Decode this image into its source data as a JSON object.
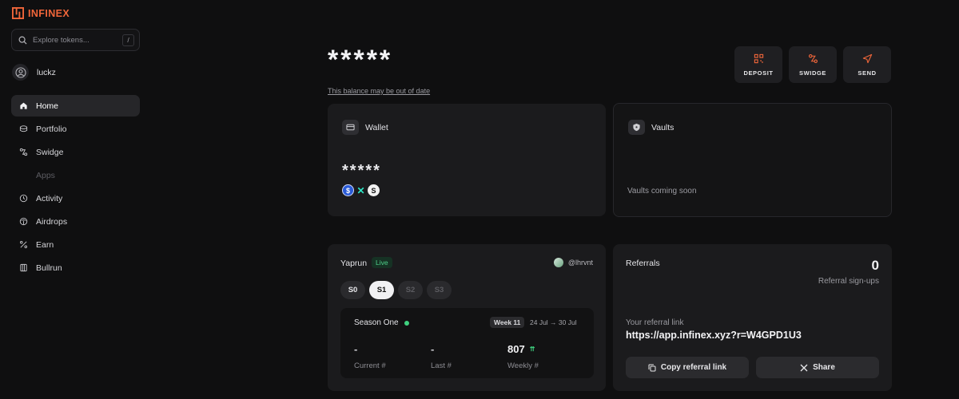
{
  "brand": {
    "name": "INFINEX",
    "accent": "#f0663a"
  },
  "search": {
    "placeholder": "Explore tokens...",
    "shortcut": "/"
  },
  "user": {
    "name": "luckz"
  },
  "nav": [
    {
      "label": "Home",
      "icon": "home-icon",
      "active": true
    },
    {
      "label": "Portfolio",
      "icon": "coins-icon"
    },
    {
      "label": "Swidge",
      "icon": "swidge-icon"
    },
    {
      "label": "Apps",
      "icon": "apps-icon",
      "disabled": true
    },
    {
      "label": "Activity",
      "icon": "clock-icon"
    },
    {
      "label": "Airdrops",
      "icon": "airdrop-icon"
    },
    {
      "label": "Earn",
      "icon": "percent-icon"
    },
    {
      "label": "Bullrun",
      "icon": "book-icon"
    }
  ],
  "header": {
    "balance": "*****",
    "balance_note": "This balance may be out of date",
    "actions": {
      "deposit": "DEPOSIT",
      "swidge": "SWIDGE",
      "send": "SEND"
    }
  },
  "wallet": {
    "title": "Wallet",
    "amount": "*****",
    "tokens": [
      "usdc-icon",
      "x-token-icon",
      "s-token-icon"
    ]
  },
  "vaults": {
    "title": "Vaults",
    "note": "Vaults coming soon"
  },
  "yaprun": {
    "title": "Yaprun",
    "status": "Live",
    "handle": "@lhrvnt",
    "seasons": [
      "S0",
      "S1",
      "S2",
      "S3"
    ],
    "active_season": "S1",
    "season_name": "Season One",
    "week": "Week 11",
    "dates": "24 Jul → 30 Jul",
    "stats": [
      {
        "value": "-",
        "label": "Current #"
      },
      {
        "value": "-",
        "label": "Last #"
      },
      {
        "value": "807",
        "label": "Weekly #"
      }
    ]
  },
  "referrals": {
    "title": "Referrals",
    "count": "0",
    "count_label": "Referral sign-ups",
    "link_label": "Your referral link",
    "link": "https://app.infinex.xyz?r=W4GPD1U3",
    "copy_label": "Copy referral link",
    "share_label": "Share"
  }
}
